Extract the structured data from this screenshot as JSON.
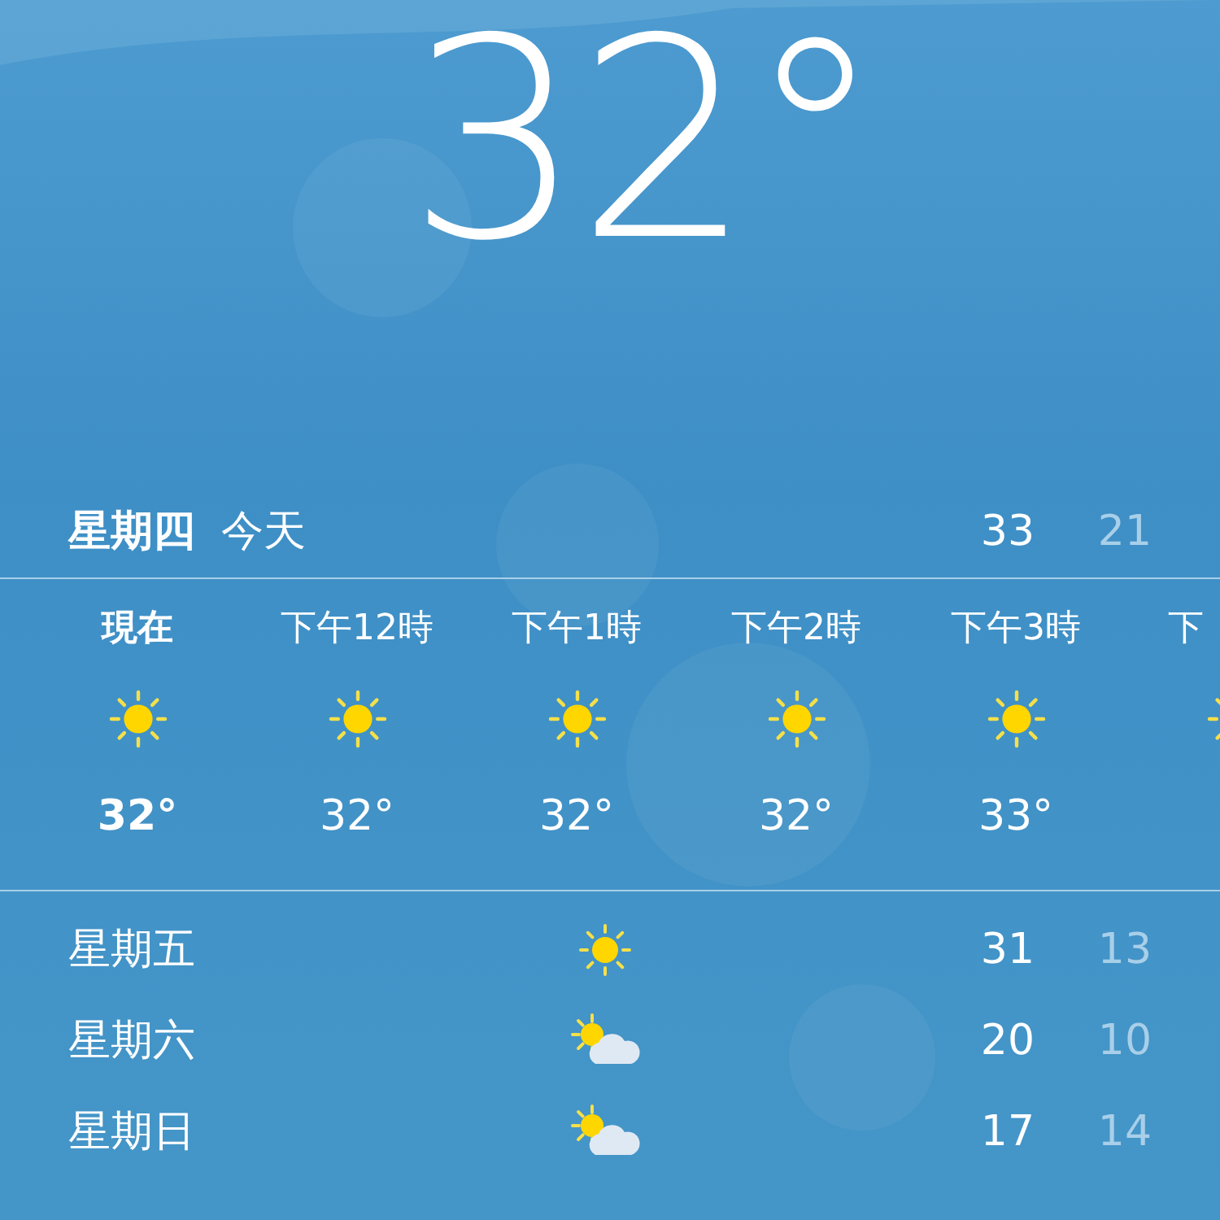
{
  "current": {
    "temperature": "32°"
  },
  "today": {
    "day": "星期四",
    "label": "今天",
    "high": "33",
    "low": "21"
  },
  "hourly": [
    {
      "time": "現在",
      "kind": "sun",
      "temp": "32°",
      "selected": true
    },
    {
      "time": "下午12時",
      "kind": "sun",
      "temp": "32°",
      "selected": false
    },
    {
      "time": "下午1時",
      "kind": "sun",
      "temp": "32°",
      "selected": false
    },
    {
      "time": "下午2時",
      "kind": "sun",
      "temp": "32°",
      "selected": false
    },
    {
      "time": "下午3時",
      "kind": "sun",
      "temp": "33°",
      "selected": false
    },
    {
      "time": "下",
      "kind": "sun",
      "selected": false
    }
  ],
  "daily": [
    {
      "day": "星期五",
      "kind": "sun",
      "high": "31",
      "low": "13"
    },
    {
      "day": "星期六",
      "kind": "partly-cloudy",
      "high": "20",
      "low": "10"
    },
    {
      "day": "星期日",
      "kind": "partly-cloudy",
      "high": "17",
      "low": "14"
    }
  ]
}
